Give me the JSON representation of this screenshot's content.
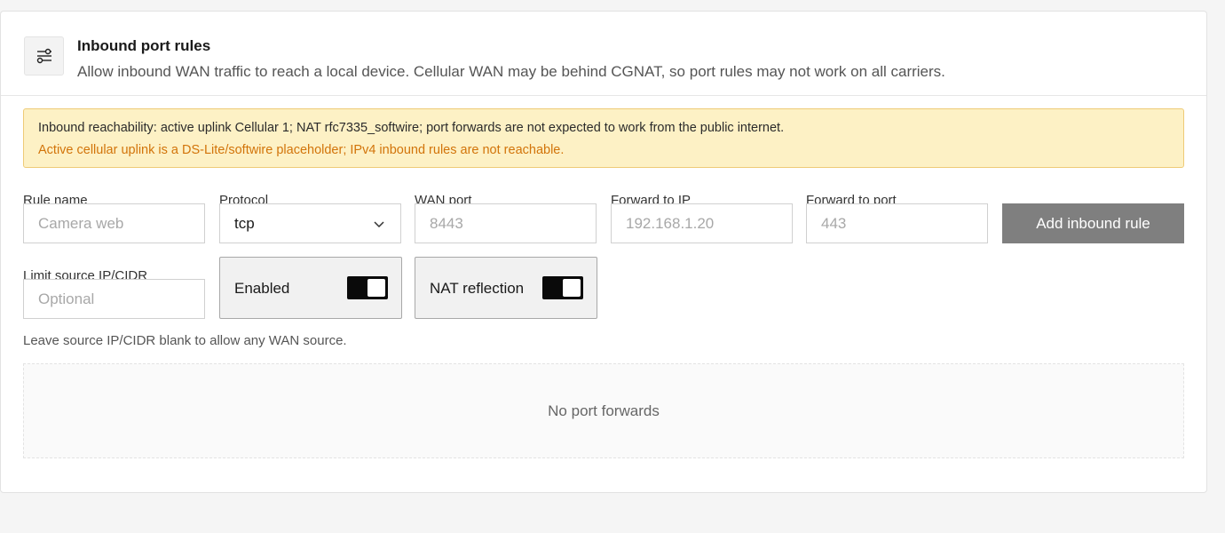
{
  "header": {
    "title": "Inbound port rules",
    "description": "Allow inbound WAN traffic to reach a local device. Cellular WAN may be behind CGNAT, so port rules may not work on all carriers.",
    "icon": "sliders-icon"
  },
  "alert": {
    "label": "Inbound reachability:",
    "message": "active uplink Cellular 1; NAT rfc7335_softwire; port forwards are not expected to work from the public internet.",
    "warning": "Active cellular uplink is a DS-Lite/softwire placeholder; IPv4 inbound rules are not reachable.",
    "warning_color": "#d2740a"
  },
  "form": {
    "rule_name": {
      "label": "Rule name",
      "placeholder": "Camera web",
      "value": ""
    },
    "protocol": {
      "label": "Protocol",
      "value": "tcp"
    },
    "wan_port": {
      "label": "WAN port",
      "placeholder": "8443",
      "value": ""
    },
    "forward_ip": {
      "label": "Forward to IP",
      "placeholder": "192.168.1.20",
      "value": ""
    },
    "forward_port": {
      "label": "Forward to port",
      "placeholder": "443",
      "value": ""
    },
    "add_button": "Add inbound rule",
    "source_cidr": {
      "label": "Limit source IP/CIDR",
      "placeholder": "Optional",
      "value": ""
    },
    "enabled": {
      "label": "Enabled",
      "checked": true
    },
    "nat_reflection": {
      "label": "NAT reflection",
      "checked": true
    },
    "hint": "Leave source IP/CIDR blank to allow any WAN source."
  },
  "rules": {
    "empty_text": "No port forwards",
    "items": []
  },
  "colors": {
    "alert_bg": "#fdf1c5",
    "alert_border": "#eecb77",
    "button_bg": "#7f7f7f"
  }
}
